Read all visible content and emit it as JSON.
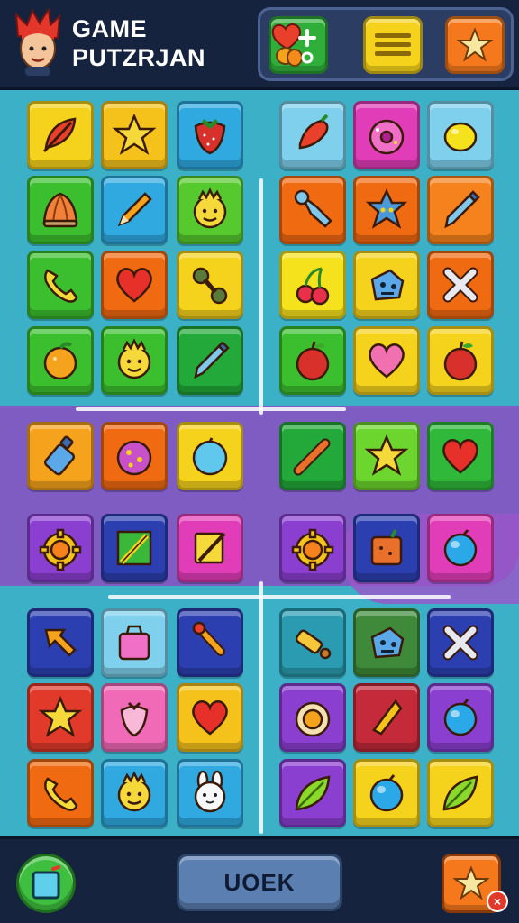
{
  "header": {
    "title_line1": "GAME",
    "title_line2": "PUTZRJAN",
    "hud_buttons": [
      {
        "name": "boosters-button",
        "icon": "heart-fruit-icon",
        "color": "#2fae3a"
      },
      {
        "name": "menu-button",
        "icon": "menu-icon",
        "color": "#f5d21c"
      },
      {
        "name": "favorites-button",
        "icon": "star-icon",
        "color": "#f5781c"
      }
    ]
  },
  "board": {
    "tiles": [
      {
        "color": "#f5d21c",
        "icon": "feather-icon"
      },
      {
        "color": "#f5c21c",
        "icon": "star-icon"
      },
      {
        "color": "#2fa9e0",
        "icon": "strawberry-icon"
      },
      {
        "color": "#7fd0ec",
        "icon": "pepper-icon"
      },
      {
        "color": "#e23db8",
        "icon": "donut-icon"
      },
      {
        "color": "#7fd0ec",
        "icon": "lemon-icon"
      },
      {
        "color": "#3cbf2e",
        "icon": "onion-icon"
      },
      {
        "color": "#2fa9e0",
        "icon": "pencil-icon"
      },
      {
        "color": "#56c92e",
        "icon": "smiley-icon"
      },
      {
        "color": "#f06a12",
        "icon": "wrench-icon"
      },
      {
        "color": "#f06a12",
        "icon": "robot-star-icon"
      },
      {
        "color": "#f5821c",
        "icon": "blue-pen-icon"
      },
      {
        "color": "#3cbf2e",
        "icon": "phone-icon"
      },
      {
        "color": "#f06a12",
        "icon": "heart-icon"
      },
      {
        "color": "#f5d21c",
        "icon": "dumbbell-icon"
      },
      {
        "color": "#f5e21c",
        "icon": "cherries-icon"
      },
      {
        "color": "#f5d21c",
        "icon": "robot-icon"
      },
      {
        "color": "#f06a12",
        "icon": "cross-icon"
      },
      {
        "color": "#3cbf2e",
        "icon": "orange-icon"
      },
      {
        "color": "#3cbf2e",
        "icon": "smiley-icon"
      },
      {
        "color": "#23a83a",
        "icon": "blue-pen-icon"
      },
      {
        "color": "#3cbf2e",
        "icon": "apple-icon"
      },
      {
        "color": "#f5d21c",
        "icon": "pink-heart-icon"
      },
      {
        "color": "#f5d21c",
        "icon": "apple-icon"
      },
      {
        "color": "#f5a21c",
        "icon": "bottle-icon"
      },
      {
        "color": "#f06a12",
        "icon": "cookie-icon"
      },
      {
        "color": "#f5d21c",
        "icon": "ball-icon"
      },
      {
        "color": "#23a83a",
        "icon": "stick-icon"
      },
      {
        "color": "#6dd62e",
        "icon": "star-icon"
      },
      {
        "color": "#2fb83a",
        "icon": "heart-icon"
      },
      {
        "color": "#8a3fd0",
        "icon": "gear-icon"
      },
      {
        "color": "#2c3fb0",
        "icon": "green-pencil-icon"
      },
      {
        "color": "#e23db8",
        "icon": "pencil-note-icon"
      },
      {
        "color": "#8a3fd0",
        "icon": "gear-icon"
      },
      {
        "color": "#2c3fb0",
        "icon": "box-icon"
      },
      {
        "color": "#e23db8",
        "icon": "blueberry-icon"
      },
      {
        "color": "#2c3fb0",
        "icon": "arrow-icon"
      },
      {
        "color": "#7fd0ec",
        "icon": "gift-icon"
      },
      {
        "color": "#2c3fb0",
        "icon": "brush-icon"
      },
      {
        "color": "#2a9bb0",
        "icon": "bottle-gold-icon"
      },
      {
        "color": "#3e8a3a",
        "icon": "robot-icon"
      },
      {
        "color": "#2c3fb0",
        "icon": "cross-icon"
      },
      {
        "color": "#e23a2a",
        "icon": "star-icon"
      },
      {
        "color": "#f06ab8",
        "icon": "strawberry-outline-icon"
      },
      {
        "color": "#f5c21c",
        "icon": "heart-icon"
      },
      {
        "color": "#8a3fd0",
        "icon": "ring-icon"
      },
      {
        "color": "#c42a3a",
        "icon": "cheese-icon"
      },
      {
        "color": "#8a3fd0",
        "icon": "blueberry-icon"
      },
      {
        "color": "#f06a12",
        "icon": "phone-icon"
      },
      {
        "color": "#2fa9e0",
        "icon": "smiley-icon"
      },
      {
        "color": "#2fa9e0",
        "icon": "bunny-icon"
      },
      {
        "color": "#8a3fd0",
        "icon": "leaf-icon"
      },
      {
        "color": "#f5d21c",
        "icon": "blueberry-icon"
      },
      {
        "color": "#f5d21c",
        "icon": "leaf-icon"
      }
    ]
  },
  "footer": {
    "left_icon": "cube-icon",
    "main_button_label": "UOEK",
    "right_icon": "star-icon",
    "close_badge": "×"
  }
}
